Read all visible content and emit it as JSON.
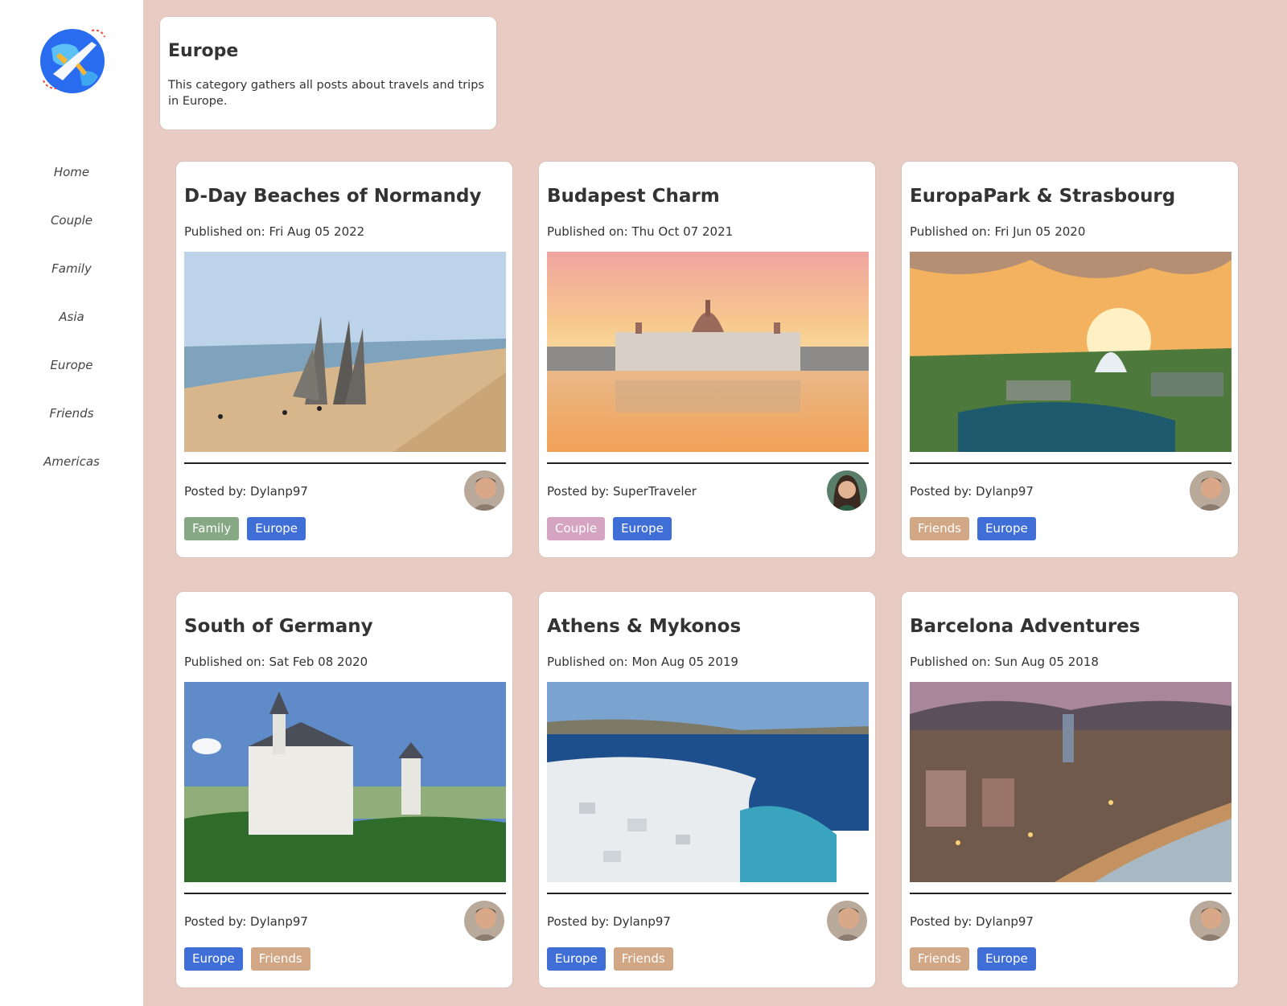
{
  "sidebar": {
    "logo": "airplane-globe-logo",
    "nav": [
      "Home",
      "Couple",
      "Family",
      "Asia",
      "Europe",
      "Friends",
      "Americas"
    ]
  },
  "category": {
    "title": "Europe",
    "description": "This category gathers all posts about travels and trips in Europe."
  },
  "colors": {
    "page_bg": "#e8cbc3",
    "tag_europe": "#3f6fd6",
    "tag_family": "#86a884",
    "tag_couple": "#d5a4c2",
    "tag_friends": "#d1a786"
  },
  "posts": [
    {
      "title": "D-Day Beaches of Normandy",
      "date": "Published on: Fri Aug 05 2022",
      "author": "Posted by: Dylanp97",
      "avatar": "man-avatar",
      "image": "normandy-beach",
      "tags": [
        {
          "label": "Family",
          "color": "#86a884"
        },
        {
          "label": "Europe",
          "color": "#3f6fd6"
        }
      ]
    },
    {
      "title": "Budapest Charm",
      "date": "Published on: Thu Oct 07 2021",
      "author": "Posted by: SuperTraveler",
      "avatar": "woman-avatar",
      "image": "budapest-parliament",
      "tags": [
        {
          "label": "Couple",
          "color": "#d5a4c2"
        },
        {
          "label": "Europe",
          "color": "#3f6fd6"
        }
      ]
    },
    {
      "title": "EuropaPark & Strasbourg",
      "date": "Published on: Fri Jun 05 2020",
      "author": "Posted by: Dylanp97",
      "avatar": "man-avatar",
      "image": "europapark",
      "tags": [
        {
          "label": "Friends",
          "color": "#d1a786"
        },
        {
          "label": "Europe",
          "color": "#3f6fd6"
        }
      ]
    },
    {
      "title": "South of Germany",
      "date": "Published on: Sat Feb 08 2020",
      "author": "Posted by: Dylanp97",
      "avatar": "man-avatar",
      "image": "neuschwanstein-castle",
      "tags": [
        {
          "label": "Europe",
          "color": "#3f6fd6"
        },
        {
          "label": "Friends",
          "color": "#d1a786"
        }
      ]
    },
    {
      "title": "Athens & Mykonos",
      "date": "Published on: Mon Aug 05 2019",
      "author": "Posted by: Dylanp97",
      "avatar": "man-avatar",
      "image": "mykonos-town",
      "tags": [
        {
          "label": "Europe",
          "color": "#3f6fd6"
        },
        {
          "label": "Friends",
          "color": "#d1a786"
        }
      ]
    },
    {
      "title": "Barcelona Adventures",
      "date": "Published on: Sun Aug 05 2018",
      "author": "Posted by: Dylanp97",
      "avatar": "man-avatar",
      "image": "barcelona-night",
      "tags": [
        {
          "label": "Friends",
          "color": "#d1a786"
        },
        {
          "label": "Europe",
          "color": "#3f6fd6"
        }
      ]
    }
  ]
}
